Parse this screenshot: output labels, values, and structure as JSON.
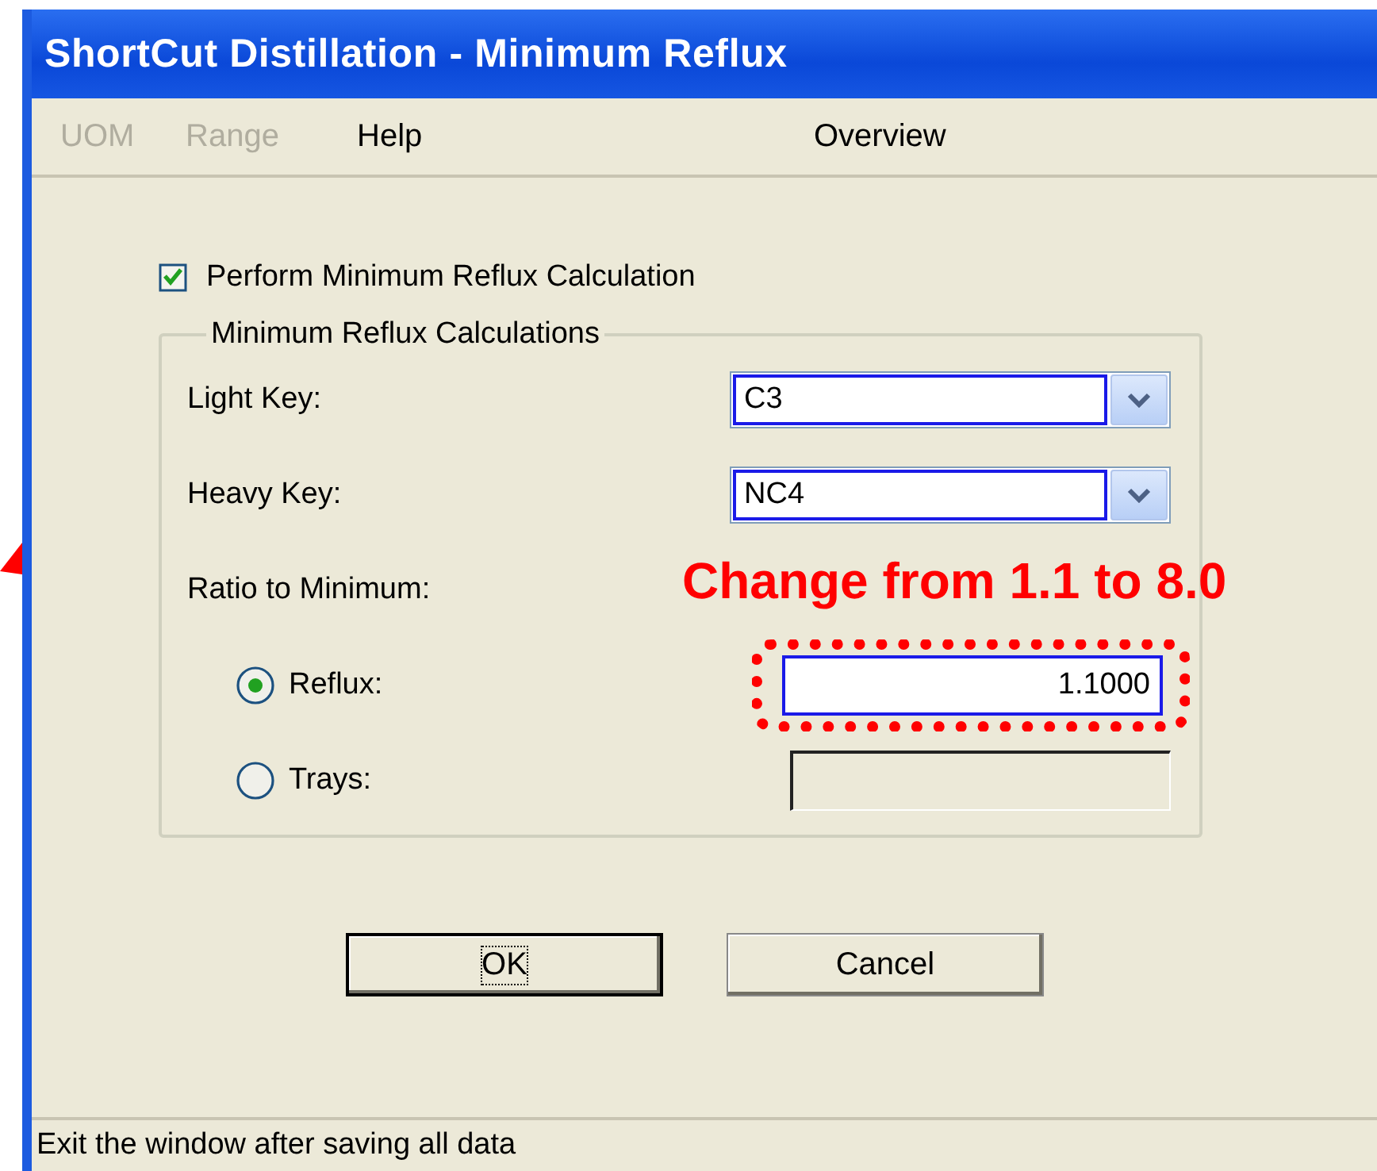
{
  "window": {
    "title": "ShortCut Distillation - Minimum Reflux"
  },
  "menu": [
    {
      "label": "UOM",
      "disabled": true
    },
    {
      "label": "Range",
      "disabled": true
    },
    {
      "label": "Help",
      "disabled": false
    },
    {
      "label": "Overview",
      "disabled": false
    }
  ],
  "perform_checkbox": {
    "label": "Perform Minimum Reflux Calculation",
    "checked": true
  },
  "group": {
    "title": "Minimum Reflux Calculations",
    "light_key": {
      "label": "Light Key:",
      "value": "C3"
    },
    "heavy_key": {
      "label": "Heavy Key:",
      "value": "NC4"
    },
    "ratio_label": "Ratio to Minimum:",
    "options": [
      {
        "label": "Reflux:",
        "selected": true,
        "value": "1.1000",
        "disabled": false,
        "highlighted": true
      },
      {
        "label": "Trays:",
        "selected": false,
        "disabled": true,
        "highlighted": false
      }
    ]
  },
  "annotation": {
    "text": "Change from 1.1 to 8.0"
  },
  "buttons": [
    {
      "label": "OK",
      "focused": true
    },
    {
      "label": "Cancel",
      "focused": false
    }
  ],
  "status_bar": "Exit the window after saving all data"
}
